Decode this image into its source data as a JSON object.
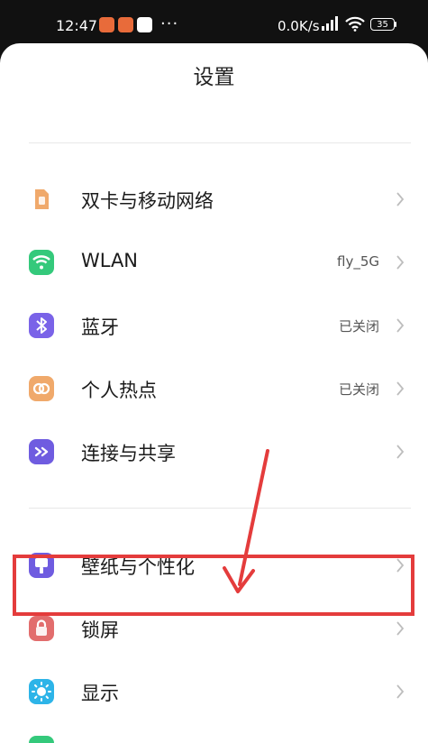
{
  "status_bar": {
    "time": "12:47",
    "network_speed": "0.0K/s",
    "battery": "35",
    "more_dots": "···"
  },
  "header": {
    "title": "设置"
  },
  "settings": {
    "items": [
      {
        "label": "双卡与移动网络",
        "value": "",
        "icon": "sim-card-icon",
        "color": "#F0A96B"
      },
      {
        "label": "WLAN",
        "value": "fly_5G",
        "icon": "wifi-icon",
        "color": "#34C97B"
      },
      {
        "label": "蓝牙",
        "value": "已关闭",
        "icon": "bluetooth-icon",
        "color": "#7A63E8"
      },
      {
        "label": "个人热点",
        "value": "已关闭",
        "icon": "hotspot-icon",
        "color": "#F0A96B"
      },
      {
        "label": "连接与共享",
        "value": "",
        "icon": "share-icon",
        "color": "#6F5CE0"
      },
      {
        "label": "壁纸与个性化",
        "value": "",
        "icon": "wallpaper-icon",
        "color": "#6F5CE0"
      },
      {
        "label": "锁屏",
        "value": "",
        "icon": "lock-icon",
        "color": "#E26D6D"
      },
      {
        "label": "显示",
        "value": "",
        "icon": "display-icon",
        "color": "#2DB4E8"
      }
    ]
  },
  "annotation": {
    "color": "#E43C3C"
  }
}
